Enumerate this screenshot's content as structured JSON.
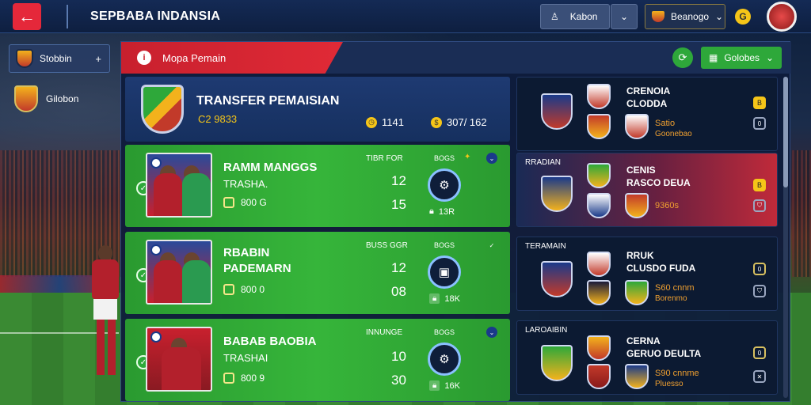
{
  "topbar": {
    "back_icon": "arrow-left-icon",
    "title": "SEPBABA INDANSIA",
    "profile_label": "Kabon",
    "club_label": "Beanogo",
    "coin_glyph": "G"
  },
  "sidebar": {
    "items": [
      {
        "label": "Stobbin",
        "action_glyph": "+"
      },
      {
        "label": "Gilobon"
      }
    ]
  },
  "panel": {
    "header_label": "Mopa Pemain",
    "header_icon_glyph": "i",
    "confirm_label": "Golobes"
  },
  "summary": {
    "title": "TRANSFER PEMAISIAN",
    "code": "C2 9833",
    "stat1": "1141",
    "stat2": "307/ 162"
  },
  "players": [
    {
      "name": "RAMM MANGGS",
      "sub": "TRASHA.",
      "meta": "800 G",
      "col_title": "TIBR FOR",
      "num1": "12",
      "num2": "15",
      "gauge_title": "BOGS",
      "tag": "13R"
    },
    {
      "name": "RBABIN",
      "sub": "PADEMARN",
      "meta": "800 0",
      "col_title": "BUSS GGR",
      "num1": "12",
      "num2": "08",
      "gauge_title": "BOGS",
      "tag": "18K"
    },
    {
      "name": "BABAB BAOBIA",
      "sub": "TRASHAI",
      "meta": "800 9",
      "col_title": "INNUNGE",
      "num1": "10",
      "num2": "30",
      "gauge_title": "BOGS",
      "tag": "16K"
    }
  ],
  "matches": [
    {
      "label": "",
      "title1": "CRENOIA",
      "title2": "CLODDA",
      "sub1": "Satio",
      "sub2": "Goonebao",
      "badge": "B"
    },
    {
      "label": "RRADIAN",
      "title1": "CENIS",
      "title2": "RASCO DEUA",
      "sub1": "9360s",
      "sub2": "",
      "badge": "B"
    },
    {
      "label": "TERAMAIN",
      "title1": "RRUK",
      "title2": "CLUSDO FUDA",
      "sub1": "S60 cnnm",
      "sub2": "Borenmo",
      "badge": "0"
    },
    {
      "label": "LAROAIBIN",
      "title1": "CERNA",
      "title2": "GERUO DEULTA",
      "sub1": "S90 cnnme",
      "sub2": "Pluesso",
      "badge": "0"
    }
  ],
  "colors": {
    "accent_red": "#e5283a",
    "accent_green": "#2ea83a",
    "coin": "#f5c518",
    "panel": "#0e1c3c"
  }
}
